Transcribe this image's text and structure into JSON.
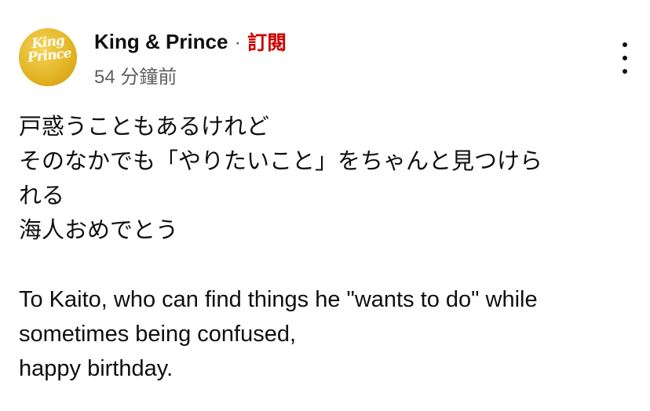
{
  "post": {
    "channel_name": "King & Prince",
    "separator": "·",
    "subscribe_label": "訂閱",
    "timestamp": "54 分鐘前",
    "avatar_text_line1": "King",
    "avatar_text_line2": "Prince",
    "more_icon": "more-vert-icon",
    "body_text": "戸惑うこともあるけれど\nそのなかでも「やりたいこと」をちゃんと見つけら\nれる\n海人おめでとう\n\nTo Kaito, who can find things he \"wants to do\" while\nsometimes being confused,\nhappy birthday."
  },
  "colors": {
    "subscribe": "#cc0000",
    "text_primary": "#0f0f0f",
    "text_secondary": "#606060",
    "avatar_bg": "#e2b321"
  }
}
